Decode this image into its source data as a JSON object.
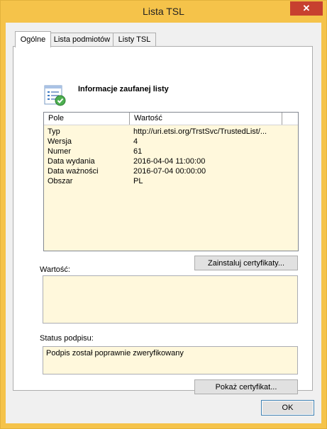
{
  "window": {
    "title": "Lista TSL",
    "close_glyph": "✕"
  },
  "tabs": [
    {
      "label": "Ogólne",
      "active": true
    },
    {
      "label": "Lista podmiotów",
      "active": false
    },
    {
      "label": "Listy TSL",
      "active": false
    }
  ],
  "header": {
    "icon": "certificate-list-icon",
    "text": "Informacje zaufanej listy"
  },
  "listview": {
    "columns": [
      "Pole",
      "Wartość"
    ],
    "rows": [
      {
        "field": "Typ",
        "value": "http://uri.etsi.org/TrstSvc/TrustedList/..."
      },
      {
        "field": "Wersja",
        "value": "4"
      },
      {
        "field": "Numer",
        "value": "61"
      },
      {
        "field": "Data wydania",
        "value": "2016-04-04 11:00:00"
      },
      {
        "field": "Data ważności",
        "value": "2016-07-04 00:00:00"
      },
      {
        "field": "Obszar",
        "value": "PL"
      }
    ]
  },
  "install_button": "Zainstaluj certyfikaty...",
  "value_label": "Wartość:",
  "value_text": "",
  "status_label": "Status podpisu:",
  "status_text": "Podpis został poprawnie zweryfikowany",
  "show_cert_button": "Pokaż certyfikat...",
  "ok_button": "OK",
  "colors": {
    "titlebar": "#f5c34a",
    "close": "#c7402f",
    "field_bg": "#fff8dc"
  }
}
